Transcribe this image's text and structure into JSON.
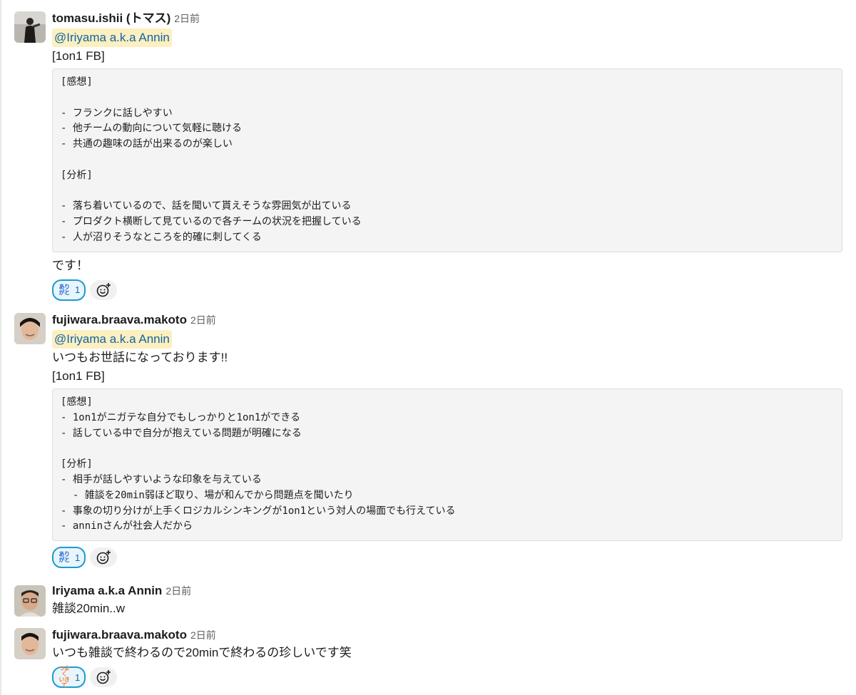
{
  "messages": [
    {
      "author": "tomasu.ishii (トマス)",
      "time": "2日前",
      "mention": "@Iriyama a.k.a Annin",
      "text_before": [
        "[1on1 FB]"
      ],
      "code": [
        "[感想]",
        "",
        "- フランクに話しやすい",
        "- 他チームの動向について気軽に聴ける",
        "- 共通の趣味の話が出来るのが楽しい",
        "",
        "[分析]",
        "",
        "- 落ち着いているので、話を聞いて貰えそうな雰囲気が出ている",
        "- プロダクト横断して見ているので各チームの状況を把握している",
        "- 人が沼りそうなところを的確に刺してくる"
      ],
      "text_after": [
        "です！"
      ],
      "reaction": {
        "emoji": "arigato-emoji",
        "emoji_text": [
          "あり",
          "がと"
        ],
        "count": "1"
      }
    },
    {
      "author": "fujiwara.braava.makoto",
      "time": "2日前",
      "mention": "@Iriyama a.k.a Annin",
      "text_before": [
        "いつもお世話になっております!!",
        "[1on1 FB]"
      ],
      "code": [
        "[感想]",
        "- 1on1がニガテな自分でもしっかりと1on1ができる",
        "- 話している中で自分が抱えている問題が明確になる",
        "",
        "[分析]",
        "- 相手が話しやすいような印象を与えている",
        "  - 雑談を20min弱ほど取り、場が和んでから問題点を聞いたり",
        "- 事象の切り分けが上手くロジカルシンキングが1on1という対人の場面でも行えている",
        "- anninさんが社会人だから"
      ],
      "reaction": {
        "emoji": "arigato-emoji",
        "emoji_text": [
          "あり",
          "がと"
        ],
        "count": "1"
      }
    },
    {
      "author": "Iriyama a.k.a Annin",
      "time": "2日前",
      "text": "雑談20min..w"
    },
    {
      "author": "fujiwara.braava.makoto",
      "time": "2日前",
      "text": "いつも雑談で終わるので20minで終わるの珍しいです笑",
      "reaction": {
        "emoji": "otsukare-emoji",
        "emoji_text": [
          "つよく",
          "いきて"
        ],
        "count": "1"
      }
    }
  ],
  "icons": {
    "add_reaction": "add-reaction-icon"
  },
  "colors": {
    "mention_bg": "#fcefc0",
    "mention_text": "#1264a3",
    "reaction_border": "#1d9bd1"
  }
}
